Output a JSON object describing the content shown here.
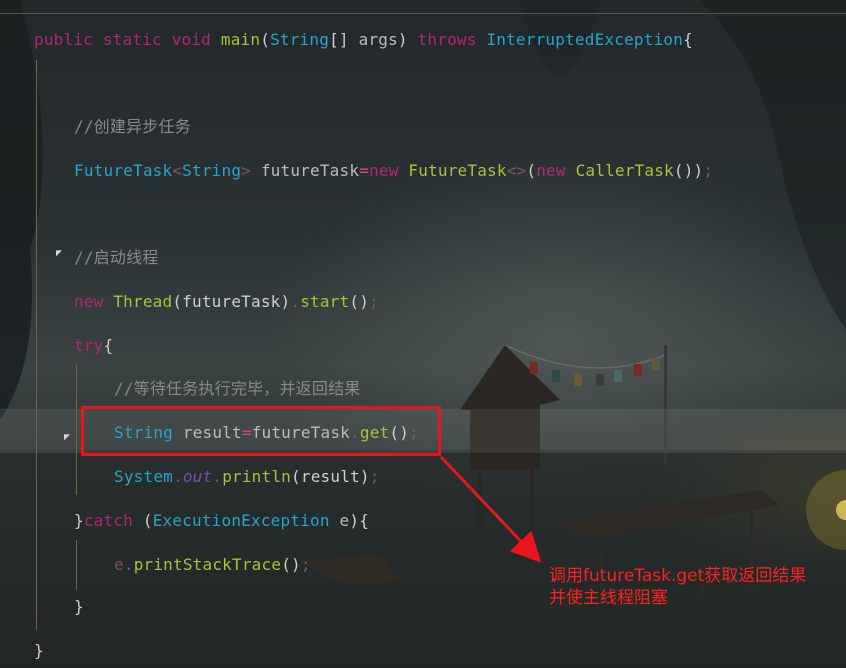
{
  "code": {
    "line1": {
      "kw1": "public",
      "kw2": "static",
      "kw3": "void",
      "name": "main",
      "open": "(",
      "type": "String",
      "arr": "[]",
      "arg": " args",
      "close": ")",
      "throws": "throws",
      "exc": "InterruptedException",
      "brace": "{"
    },
    "line2": {
      "comment": "//创建异步任务"
    },
    "line3": {
      "type1": "FutureTask",
      "lt1": "<",
      "type2": "String",
      "gt1": ">",
      "var": " futureTask",
      "eq": "=",
      "new1": "new",
      "type3": "FutureTask",
      "diamond": "<>",
      "open": "(",
      "new2": "new",
      "type4": "CallerTask",
      "call": "())",
      "semi": ";"
    },
    "line4": {
      "comment": "//启动线程"
    },
    "line5": {
      "new": "new",
      "type": "Thread",
      "args": "(futureTask)",
      "dot": ".",
      "method": "start",
      "call": "()",
      "semi": ";"
    },
    "line6": {
      "kw": "try",
      "brace": "{"
    },
    "line7": {
      "comment": "//等待任务执行完毕，并返回结果"
    },
    "line8": {
      "type": "String",
      "var": " result",
      "eq": "=",
      "obj": "futureTask",
      "dot": ".",
      "method": "get",
      "call": "()",
      "semi": ";"
    },
    "line9": {
      "type": "System",
      "dot1": ".",
      "field": "out",
      "dot2": ".",
      "method": "println",
      "args": "(result)",
      "semi": ";"
    },
    "line10": {
      "brace": "}",
      "kw": "catch",
      "open": " (",
      "type": "ExecutionException",
      "var": " e",
      "close": "){"
    },
    "line11": {
      "obj": "e",
      "dot": ".",
      "method": "printStackTrace",
      "call": "()",
      "semi": ";"
    },
    "line12": {
      "brace": "}"
    },
    "line13": {
      "brace": "}"
    }
  },
  "annotation": {
    "line1": "调用futureTask.get获取返回结果",
    "line2": "并使主线程阻塞",
    "color": "#e8161b"
  }
}
